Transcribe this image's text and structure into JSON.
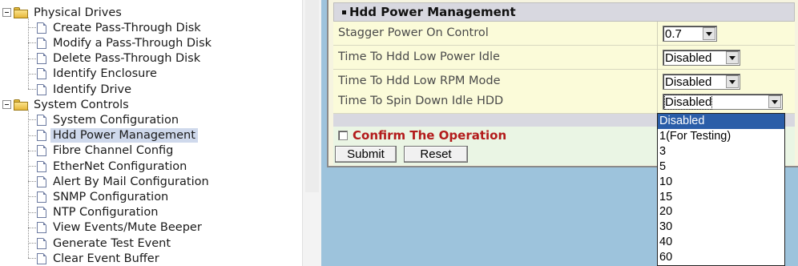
{
  "tree": {
    "groups": [
      {
        "label": "Physical Drives",
        "items": [
          {
            "label": "Create Pass-Through Disk"
          },
          {
            "label": "Modify a Pass-Through Disk"
          },
          {
            "label": "Delete Pass-Through Disk"
          },
          {
            "label": "Identify Enclosure"
          },
          {
            "label": "Identify Drive"
          }
        ]
      },
      {
        "label": "System Controls",
        "items": [
          {
            "label": "System Configuration"
          },
          {
            "label": "Hdd Power Management",
            "selected": true
          },
          {
            "label": "Fibre Channel Config"
          },
          {
            "label": "EtherNet Configuration"
          },
          {
            "label": "Alert By Mail Configuration"
          },
          {
            "label": "SNMP Configuration"
          },
          {
            "label": "NTP Configuration"
          },
          {
            "label": "View Events/Mute Beeper"
          },
          {
            "label": "Generate Test Event"
          },
          {
            "label": "Clear Event Buffer"
          }
        ]
      }
    ]
  },
  "panel": {
    "title": "Hdd Power Management",
    "settings": [
      {
        "label": "Stagger Power On Control",
        "value": "0.7"
      },
      {
        "label": "Time To Hdd Low Power Idle",
        "value": "Disabled"
      },
      {
        "label": "Time To Hdd Low RPM Mode",
        "value": "Disabled"
      },
      {
        "label": "Time To Spin Down Idle HDD",
        "value": "Disabled"
      }
    ],
    "confirm_label": "Confirm The Operation",
    "confirm_checked": false,
    "submit_label": "Submit",
    "reset_label": "Reset"
  },
  "dropdown": {
    "options": [
      "Disabled",
      "1(For Testing)",
      "3",
      "5",
      "10",
      "15",
      "20",
      "30",
      "40",
      "60"
    ],
    "selected": "Disabled"
  },
  "colors": {
    "frame_background": "#9dc3dc",
    "row_background": "#fbfbd9",
    "confirm_text": "#b31b1b",
    "highlight": "#2a5da8"
  }
}
